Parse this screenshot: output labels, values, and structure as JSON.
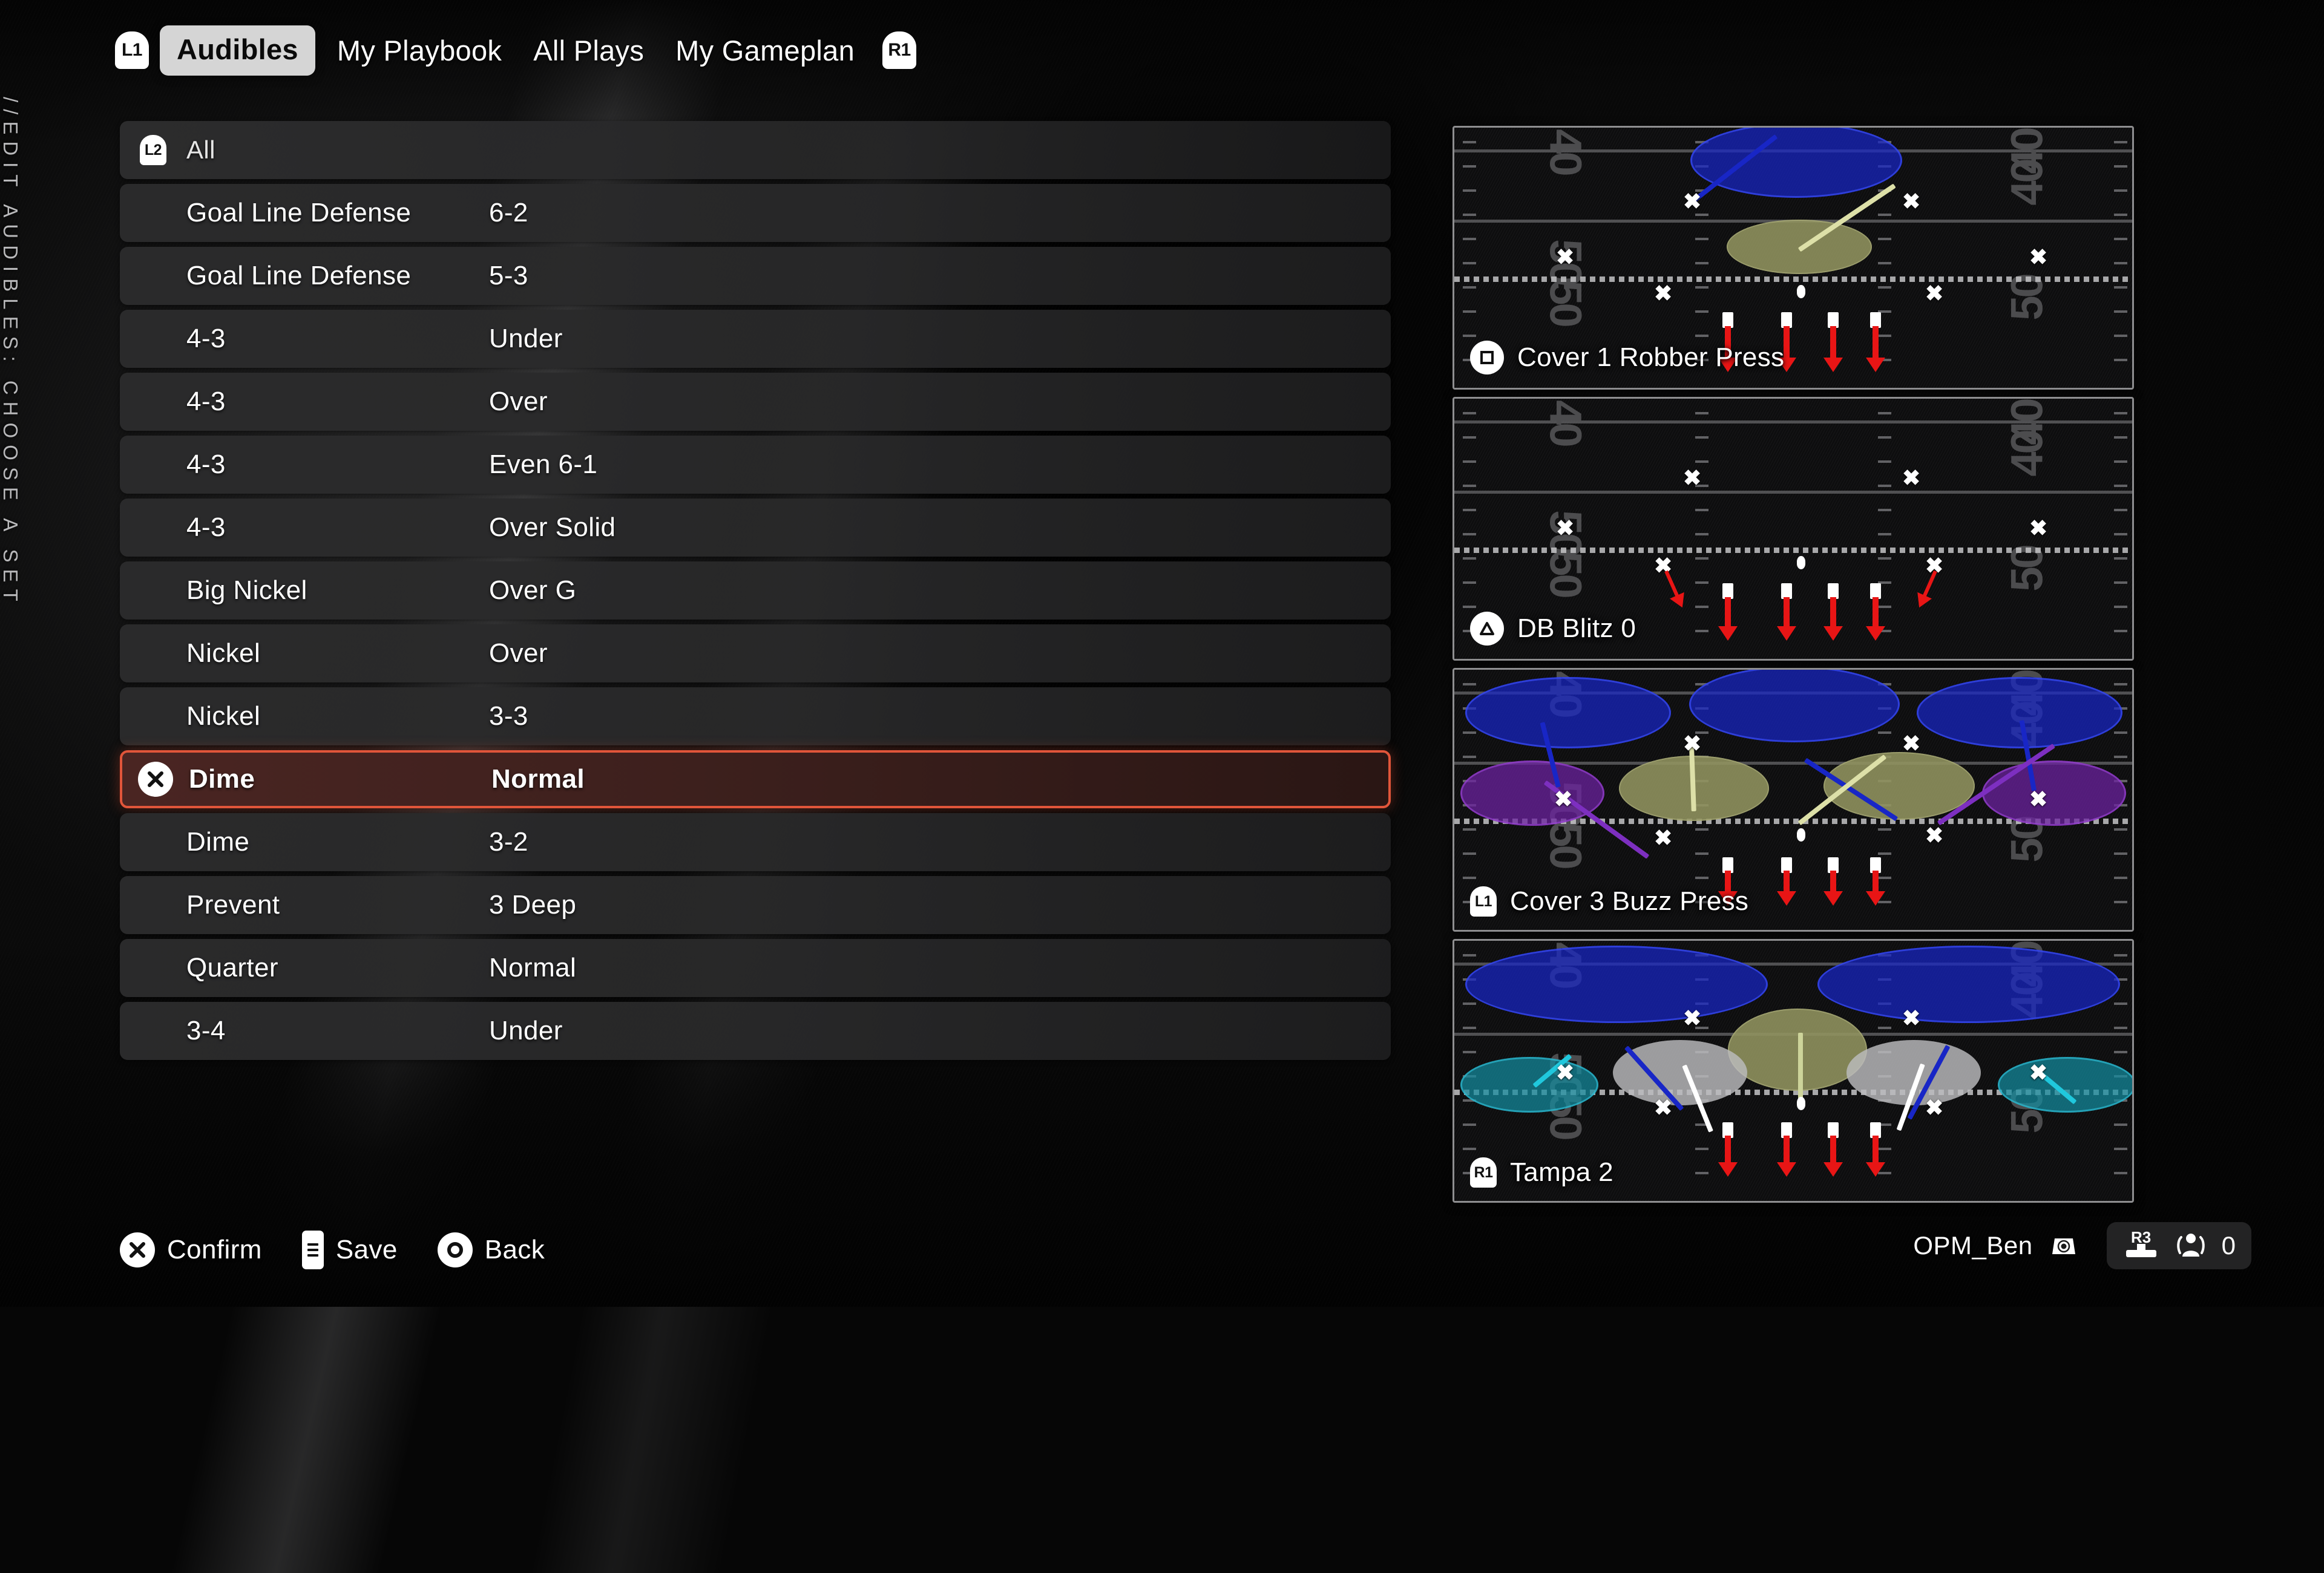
{
  "page_title": "//EDIT AUDIBLES: CHOOSE A SET",
  "topnav": {
    "left_button": "L1",
    "right_button": "R1",
    "tabs": [
      {
        "label": "Audibles",
        "selected": true
      },
      {
        "label": "My Playbook",
        "selected": false
      },
      {
        "label": "All Plays",
        "selected": false
      },
      {
        "label": "My Gameplan",
        "selected": false
      }
    ]
  },
  "list": {
    "header": {
      "button": "L2",
      "label": "All"
    },
    "selected_index": 9,
    "selected_button": "cross",
    "rows": [
      {
        "formation": "Goal Line Defense",
        "variant": "6-2"
      },
      {
        "formation": "Goal Line Defense",
        "variant": "5-3"
      },
      {
        "formation": "4-3",
        "variant": "Under"
      },
      {
        "formation": "4-3",
        "variant": "Over"
      },
      {
        "formation": "4-3",
        "variant": "Even 6-1"
      },
      {
        "formation": "4-3",
        "variant": "Over Solid"
      },
      {
        "formation": "Big Nickel",
        "variant": "Over G"
      },
      {
        "formation": "Nickel",
        "variant": "Over"
      },
      {
        "formation": "Nickel",
        "variant": "3-3"
      },
      {
        "formation": "Dime",
        "variant": "Normal"
      },
      {
        "formation": "Dime",
        "variant": "3-2"
      },
      {
        "formation": "Prevent",
        "variant": "3 Deep"
      },
      {
        "formation": "Quarter",
        "variant": "Normal"
      },
      {
        "formation": "3-4",
        "variant": "Under"
      }
    ]
  },
  "plays": [
    {
      "button": "square",
      "name": "Cover 1 Robber Press"
    },
    {
      "button": "triangle",
      "name": "DB Blitz 0"
    },
    {
      "button": "L1",
      "name": "Cover 3 Buzz Press"
    },
    {
      "button": "R1",
      "name": "Tampa 2"
    }
  ],
  "field": {
    "yard_numbers_left": [
      "40",
      "50",
      "50"
    ],
    "yard_numbers_right": [
      "40",
      "40",
      "50"
    ]
  },
  "actions": [
    {
      "icon": "cross-button",
      "label": "Confirm"
    },
    {
      "icon": "touchpad-button",
      "label": "Save"
    },
    {
      "icon": "circle-button",
      "label": "Back"
    }
  ],
  "user": {
    "name": "OPM_Ben",
    "mic_icon": "microphone-icon",
    "stick_button": "R3",
    "people_icon": "people-icon",
    "count": "0"
  },
  "colors": {
    "accent": "#e0553a",
    "selected_row_bg": "#3d201d",
    "deep_zone": "#1826c6",
    "hook_zone": "#929460",
    "flat_zone": "#6c22a0",
    "curl_zone": "#bcbcbe",
    "teal_zone": "#148ca0",
    "blitz_arrow": "#e81515"
  }
}
